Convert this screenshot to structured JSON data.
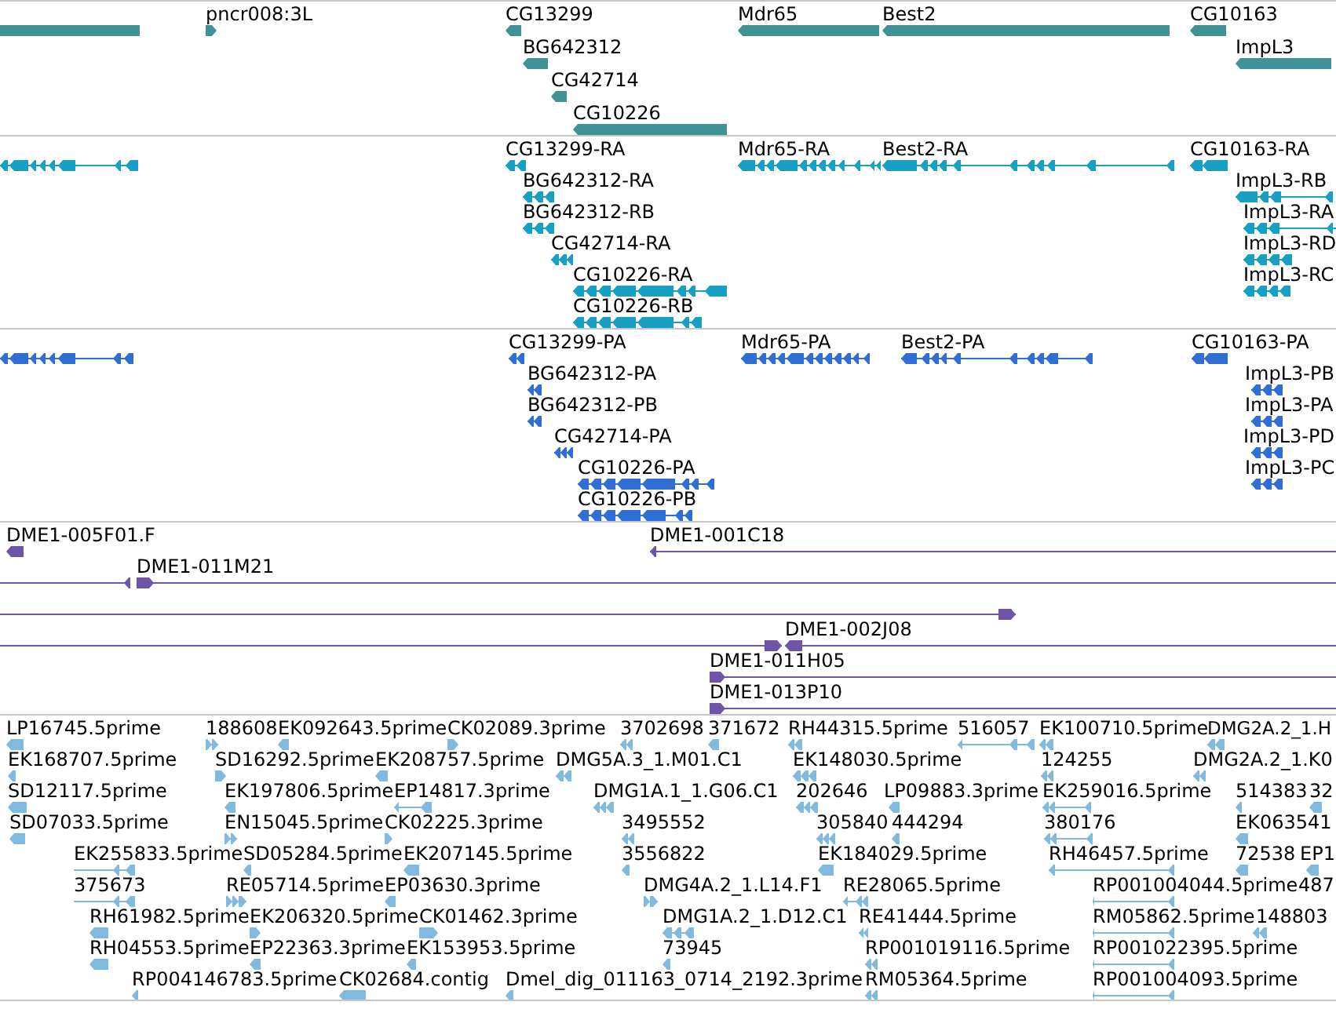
{
  "tracks": [
    {
      "kind": "gene",
      "features": [
        {
          "minus_strand": true
        },
        {
          "label": "pncr008:3L",
          "minus_strand": false
        },
        {
          "label": "CG13299",
          "minus_strand": true
        },
        {
          "label": "BG642312",
          "minus_strand": true
        },
        {
          "label": "CG42714",
          "minus_strand": true
        },
        {
          "label": "CG10226",
          "minus_strand": true
        },
        {
          "label": "Mdr65",
          "minus_strand": true
        },
        {
          "label": "Best2",
          "minus_strand": true
        },
        {
          "label": "CG10163",
          "minus_strand": true
        },
        {
          "label": "ImpL3",
          "minus_strand": true
        }
      ]
    },
    {
      "kind": "transcript",
      "features": [
        {
          "minus_strand": true
        },
        {
          "label": "CG13299-RA",
          "minus_strand": true
        },
        {
          "label": "BG642312-RA",
          "minus_strand": true
        },
        {
          "label": "BG642312-RB",
          "minus_strand": true
        },
        {
          "label": "CG42714-RA",
          "minus_strand": true
        },
        {
          "label": "CG10226-RA",
          "minus_strand": true
        },
        {
          "label": "CG10226-RB",
          "minus_strand": true
        },
        {
          "label": "Mdr65-RA",
          "minus_strand": true
        },
        {
          "label": "Best2-RA",
          "minus_strand": true
        },
        {
          "label": "CG10163-RA",
          "minus_strand": true
        },
        {
          "label": "ImpL3-RB",
          "minus_strand": true
        },
        {
          "label": "ImpL3-RA",
          "minus_strand": true
        },
        {
          "label": "ImpL3-RD",
          "minus_strand": true
        },
        {
          "label": "ImpL3-RC",
          "minus_strand": true
        }
      ]
    },
    {
      "kind": "protein",
      "features": [
        {
          "minus_strand": true
        },
        {
          "label": "CG13299-PA",
          "minus_strand": true
        },
        {
          "label": "BG642312-PA",
          "minus_strand": true
        },
        {
          "label": "BG642312-PB",
          "minus_strand": true
        },
        {
          "label": "CG42714-PA",
          "minus_strand": true
        },
        {
          "label": "CG10226-PA",
          "minus_strand": true
        },
        {
          "label": "CG10226-PB",
          "minus_strand": true
        },
        {
          "label": "Mdr65-PA",
          "minus_strand": true
        },
        {
          "label": "Best2-PA",
          "minus_strand": true
        },
        {
          "label": "CG10163-PA",
          "minus_strand": true
        },
        {
          "label": "ImpL3-PB",
          "minus_strand": true
        },
        {
          "label": "ImpL3-PA",
          "minus_strand": true
        },
        {
          "label": "ImpL3-PD",
          "minus_strand": true
        },
        {
          "label": "ImpL3-PC",
          "minus_strand": true
        }
      ]
    },
    {
      "kind": "clone",
      "features": [
        {
          "label": "DME1-005F01.F",
          "minus_strand": true
        },
        {
          "label": "DME1-001C18",
          "minus_strand": true
        },
        {
          "minus_strand": true
        },
        {
          "label": "DME1-011M21",
          "minus_strand": false
        },
        {
          "minus_strand": false
        },
        {
          "minus_strand": false
        },
        {
          "label": "DME1-002J08",
          "minus_strand": true
        },
        {
          "label": "DME1-011H05",
          "minus_strand": false
        },
        {
          "label": "DME1-013P10",
          "minus_strand": false
        }
      ]
    },
    {
      "kind": "est",
      "features": [
        {
          "label": "LP16745.5prime",
          "minus_strand": true
        },
        {
          "label": "188608",
          "minus_strand": false
        },
        {
          "label": "EK092643.5prime",
          "minus_strand": true
        },
        {
          "label": "CK02089.3prime",
          "minus_strand": false
        },
        {
          "label": "3702698",
          "minus_strand": true
        },
        {
          "label": "371672",
          "minus_strand": true
        },
        {
          "label": "RH44315.5prime",
          "minus_strand": true
        },
        {
          "label": "516057",
          "minus_strand": true
        },
        {
          "label": "EK100710.5prime",
          "minus_strand": true
        },
        {
          "label": "DMG2A.2_1.H",
          "minus_strand": true
        },
        {
          "label": "EK168707.5prime",
          "minus_strand": true
        },
        {
          "label": "SD16292.5prime",
          "minus_strand": false
        },
        {
          "label": "EK208757.5prime",
          "minus_strand": true
        },
        {
          "label": "DMG5A.3_1.M01.C1",
          "minus_strand": true
        },
        {
          "label": "EK148030.5prime",
          "minus_strand": true
        },
        {
          "label": "124255",
          "minus_strand": true
        },
        {
          "label": "DMG2A.2_1.K0",
          "minus_strand": true
        },
        {
          "label": "SD12117.5prime",
          "minus_strand": true
        },
        {
          "label": "EK197806.5prime",
          "minus_strand": true
        },
        {
          "label": "EP14817.3prime",
          "minus_strand": true
        },
        {
          "label": "DMG1A.1_1.G06.C1",
          "minus_strand": true
        },
        {
          "label": "202646",
          "minus_strand": true
        },
        {
          "label": "LP09883.3prime",
          "minus_strand": true
        },
        {
          "label": "EK259016.5prime",
          "minus_strand": true
        },
        {
          "label": "514383",
          "minus_strand": true
        },
        {
          "label": "32",
          "minus_strand": true
        },
        {
          "label": "SD07033.5prime",
          "minus_strand": true
        },
        {
          "label": "EN15045.5prime",
          "minus_strand": false
        },
        {
          "label": "CK02225.3prime",
          "minus_strand": false
        },
        {
          "label": "3495552",
          "minus_strand": true
        },
        {
          "label": "305840",
          "minus_strand": true
        },
        {
          "label": "444294",
          "minus_strand": true
        },
        {
          "label": "380176",
          "minus_strand": true
        },
        {
          "label": "EK063541",
          "minus_strand": true
        },
        {
          "label": "EK255833.5prime",
          "minus_strand": true
        },
        {
          "label": "SD05284.5prime",
          "minus_strand": true
        },
        {
          "label": "EK207145.5prime",
          "minus_strand": true
        },
        {
          "label": "3556822",
          "minus_strand": true
        },
        {
          "label": "EK184029.5prime",
          "minus_strand": true
        },
        {
          "label": "RH46457.5prime",
          "minus_strand": true
        },
        {
          "label": "72538",
          "minus_strand": true
        },
        {
          "label": "EP1",
          "minus_strand": true
        },
        {
          "label": "375673",
          "minus_strand": true
        },
        {
          "label": "RE05714.5prime",
          "minus_strand": false
        },
        {
          "label": "EP03630.3prime",
          "minus_strand": true
        },
        {
          "label": "DMG4A.2_1.L14.F1",
          "minus_strand": false
        },
        {
          "label": "RE28065.5prime",
          "minus_strand": true
        },
        {
          "label": "RP001004044.5prime",
          "minus_strand": true
        },
        {
          "label": "487"
        },
        {
          "label": "RH61982.5prime",
          "minus_strand": true
        },
        {
          "label": "EK206320.5prime",
          "minus_strand": false
        },
        {
          "label": "CK01462.3prime",
          "minus_strand": false
        },
        {
          "label": "DMG1A.2_1.D12.C1",
          "minus_strand": true
        },
        {
          "label": "RE41444.5prime",
          "minus_strand": true
        },
        {
          "label": "RM05862.5prime",
          "minus_strand": true
        },
        {
          "label": "148803",
          "minus_strand": true
        },
        {
          "label": "RH04553.5prime",
          "minus_strand": true
        },
        {
          "label": "EP22363.3prime",
          "minus_strand": true
        },
        {
          "label": "EK153953.5prime",
          "minus_strand": true
        },
        {
          "label": "73945",
          "minus_strand": true
        },
        {
          "label": "RP001019116.5prime",
          "minus_strand": true
        },
        {
          "label": "RP001022395.5prime",
          "minus_strand": true
        },
        {
          "label": "RP004146783.5prime",
          "minus_strand": true
        },
        {
          "label": "CK02684.contig",
          "minus_strand": true
        },
        {
          "label": "Dmel_dig_011163_0714_2192.3prime",
          "minus_strand": true
        },
        {
          "label": "RM05364.5prime",
          "minus_strand": true
        },
        {
          "label": "RP001004093.5prime",
          "minus_strand": true
        }
      ]
    }
  ]
}
